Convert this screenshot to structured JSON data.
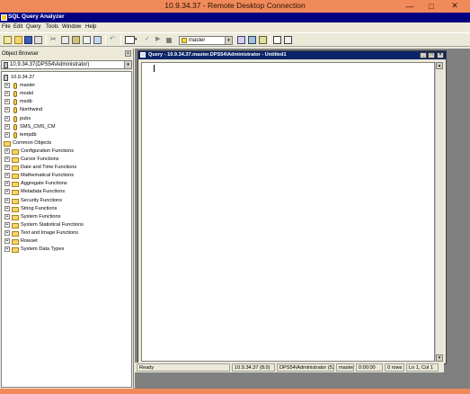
{
  "rdc": {
    "title": "10.9.34.37 - Remote Desktop Connection",
    "minimize_glyph": "—",
    "maximize_glyph": "□",
    "close_glyph": "✕"
  },
  "app": {
    "title": "SQL Query Analyzer"
  },
  "menu": [
    "File",
    "Edit",
    "Query",
    "Tools",
    "Window",
    "Help"
  ],
  "toolbar": {
    "database_value": "master",
    "dropdown_glyph": "▾"
  },
  "object_browser": {
    "title": "Object Browser",
    "server_selector": "10.9.34.37(DPS54\\Administrator)",
    "tree": {
      "server": "10.9.34.37",
      "databases": [
        "master",
        "model",
        "msdb",
        "Northwind",
        "pubs",
        "SMS_CMS_CM",
        "tempdb"
      ],
      "common_objects_label": "Common Objects",
      "common_objects": [
        "Configuration Functions",
        "Cursor Functions",
        "Date and Time Functions",
        "Mathematical Functions",
        "Aggregate Functions",
        "Metadata Functions",
        "Security Functions",
        "String Functions",
        "System Functions",
        "System Statistical Functions",
        "Text and Image Functions",
        "Rowset",
        "System Data Types"
      ]
    }
  },
  "query_window": {
    "title": "Query - 10.9.34.37.master.DPS54\\Administrator - Untitled1",
    "editor_text": ""
  },
  "status_bar": {
    "state": "Ready",
    "server": "10.9.34.37 (8.0)",
    "user": "DPS54\\Administrator (53)",
    "database": "master",
    "elapsed": "0:00:00",
    "rows": "0 rows",
    "position": "Ln 1, Col 1"
  }
}
